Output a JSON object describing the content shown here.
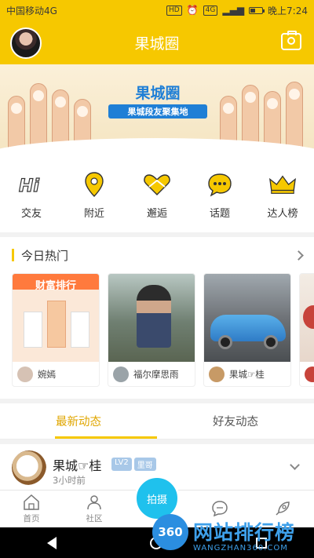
{
  "status_bar": {
    "carrier": "中国移动4G",
    "hd": "HD",
    "network": "4G",
    "time": "晚上7:24"
  },
  "header": {
    "title": "果城圈"
  },
  "banner": {
    "title": "果城圈",
    "subtitle": "果城段友聚集地"
  },
  "categories": [
    {
      "label": "交友",
      "icon": "hi-icon"
    },
    {
      "label": "附近",
      "icon": "location-pin-icon"
    },
    {
      "label": "邂逅",
      "icon": "heart-icon"
    },
    {
      "label": "话题",
      "icon": "chat-bubble-icon"
    },
    {
      "label": "达人榜",
      "icon": "crown-icon"
    }
  ],
  "hot": {
    "title": "今日热门",
    "cards": [
      {
        "name": "婉嫣",
        "image_title": "财富排行"
      },
      {
        "name": "福尔摩思雨"
      },
      {
        "name": "果城☞桂"
      },
      {
        "name": ""
      }
    ]
  },
  "tabs": [
    {
      "label": "最新动态",
      "active": true
    },
    {
      "label": "好友动态",
      "active": false
    }
  ],
  "post": {
    "name": "果城☞桂",
    "badges": [
      "LV2",
      "里哥"
    ],
    "time": "3小时前"
  },
  "tabbar": {
    "items": [
      {
        "label": "首页",
        "icon": "home-icon"
      },
      {
        "label": "社区",
        "icon": "community-icon"
      },
      {
        "label": "",
        "icon": "spacer"
      },
      {
        "label": "",
        "icon": "message-icon"
      },
      {
        "label": "",
        "icon": "rocket-icon"
      }
    ],
    "shoot_label": "拍摄"
  },
  "watermark": {
    "badge": "360",
    "text": "网站排行榜",
    "url": "WANGZHAN360.COM"
  },
  "colors": {
    "accent": "#f6c800",
    "shoot": "#1fc1ed",
    "tab_active": "#e0a600"
  }
}
